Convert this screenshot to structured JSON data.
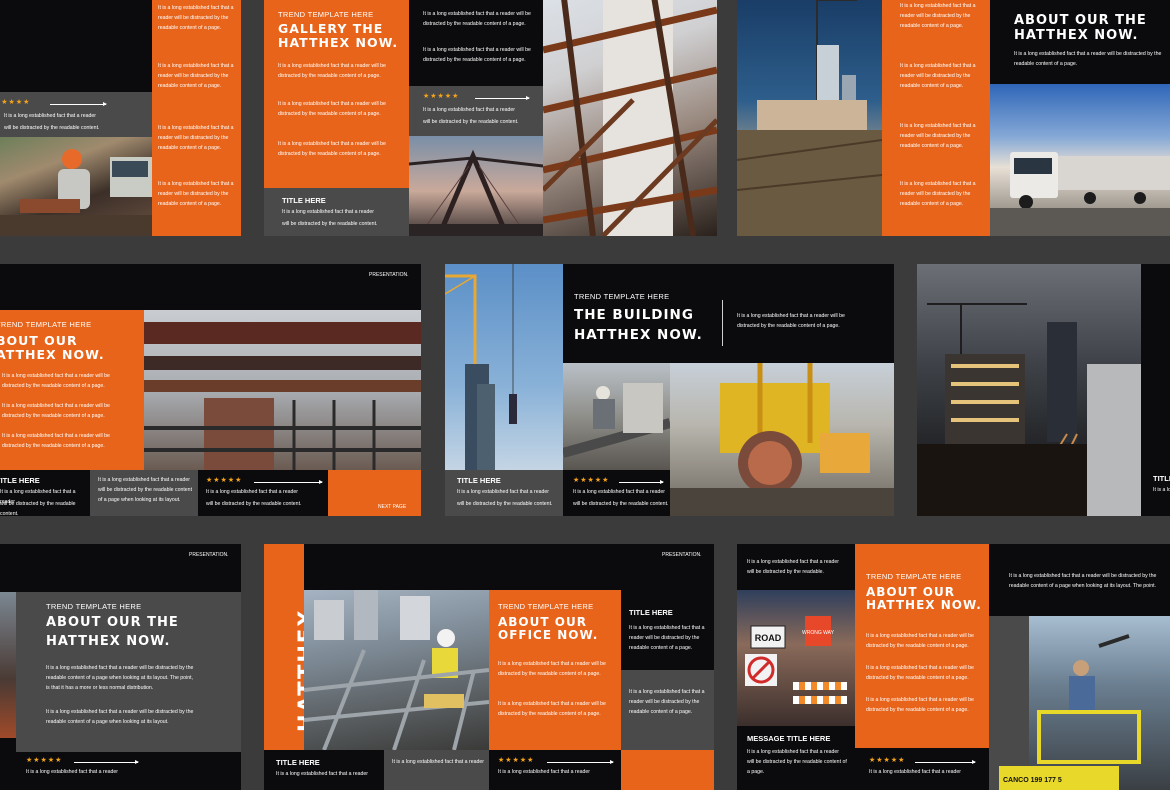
{
  "presentation_label": "PRESENTATION.",
  "lorem_short": "It is a long established fact that a reader will be distracted by the readable content of a page.",
  "lorem_reader": "It is a long established fact that a reader",
  "lorem_distracted": "will be distracted by the readable content.",
  "slide1": {
    "lines": [
      "It is a long established fact that a reader will be distracted by the",
      "readable content of a page."
    ]
  },
  "slide2": {
    "eyebrow": "TREND TEMPLATE HERE",
    "heading_l1": "GALLERY THE",
    "heading_l2": "HATTHEX NOW.",
    "title": "TITLE HERE"
  },
  "slide3": {
    "heading_l1": "ABOUT OUR THE",
    "heading_l2": "HATTHEX NOW."
  },
  "slide4": {
    "eyebrow": "TREND TEMPLATE HERE",
    "heading_l1": "BOUT OUR",
    "heading_l2": "ATTHEX NOW.",
    "title": "TITLE HERE",
    "grey_text": "It is a long established fact that a reader will be distracted by the readable content of a page when looking at its layout.",
    "next_page": "NEXT PAGE"
  },
  "slide5": {
    "eyebrow": "TREND TEMPLATE HERE",
    "heading_l1": "THE BUILDING",
    "heading_l2": "HATTHEX NOW.",
    "title": "TITLE HERE",
    "side_text": "It is a long established fact that a reader will be distracted by the readable content of a page."
  },
  "slide6": {
    "title": "TITLE"
  },
  "slide7": {
    "eyebrow": "TREND TEMPLATE HERE",
    "heading_l1": "ABOUT OUR THE",
    "heading_l2": "HATTHEX NOW.",
    "para1": "It is a long established fact that a reader will be distracted by the readable content of a page when looking at its layout. The point, is that it has a more or less normal distribution.",
    "para2": "It is a long established fact that a reader will be distracted by the readable content of a page when looking at its layout."
  },
  "slide8": {
    "brand": "HATTHEX",
    "eyebrow": "TREND TEMPLATE HERE",
    "heading_l1": "ABOUT OUR",
    "heading_l2": "OFFICE NOW.",
    "title_right": "TITLE HERE",
    "title_bottom": "TITLE HERE",
    "right_text": "It is a long established fact that a reader will be distracted by the readable content of a page."
  },
  "slide9": {
    "eyebrow": "TREND TEMPLATE HERE",
    "heading_l1": "ABOUT OUR",
    "heading_l2": "HATTHEX NOW.",
    "message_title": "MESSAGE TITLE HERE",
    "top_text": "It is a long established fact that a reader will be distracted by the readable.",
    "right_text": "It is a long established fact that a reader will be distracted by the readable content of a page when looking at its layout. The point.",
    "sign1": "ROAD",
    "sign2": "WRONG WAY",
    "truck_text": "CANCO  199 177 5"
  },
  "stars": "★★★★★",
  "colors": {
    "orange": "#e8641b",
    "dark": "#0b0b0d",
    "grey": "#4a4a4a",
    "background": "#3b3b3b",
    "star": "#f4a31a"
  }
}
